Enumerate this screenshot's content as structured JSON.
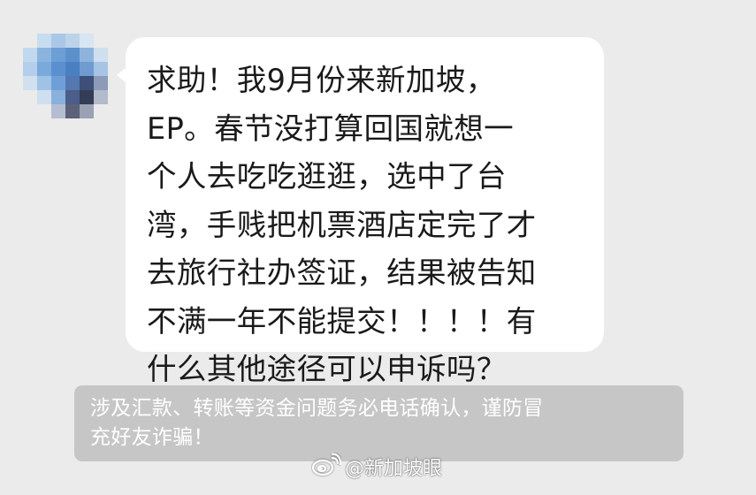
{
  "message": {
    "lines": [
      "求助！我9月份来新加坡，",
      "EP。春节没打算回国就想一",
      "个人去吃吃逛逛，选中了台",
      "湾，手贱把机票酒店定完了才",
      "去旅行社办签证，结果被告知",
      "不满一年不能提交！！！！有",
      "什么其他途径可以申诉吗？"
    ]
  },
  "notice": {
    "lines": [
      "涉及汇款、转账等资金问题务必电话确认，谨防冒",
      "充好友诈骗！"
    ]
  },
  "watermark": {
    "icon": "weibo-logo-icon",
    "text": "@新加坡眼"
  },
  "colors": {
    "background": "#ebebeb",
    "bubble": "#ffffff",
    "notice_bg": "#c6c6c6",
    "text": "#1a1a1a"
  }
}
